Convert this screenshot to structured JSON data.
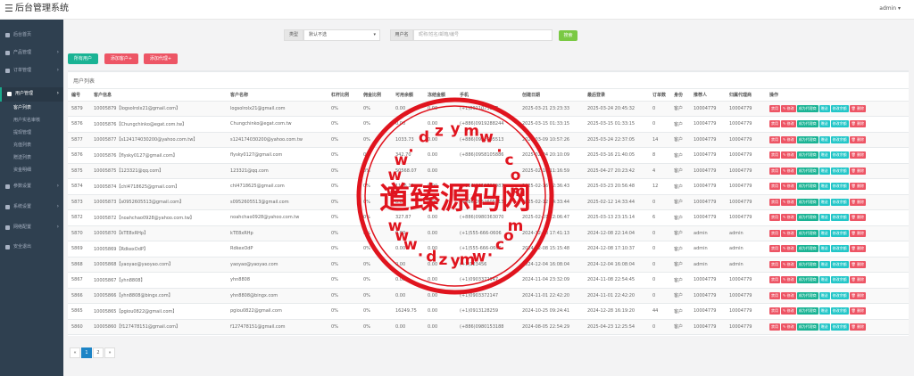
{
  "header": {
    "menu_icon": "hamburger-icon",
    "app_title": "后台管理系统",
    "user": "admin"
  },
  "sidebar": {
    "items": [
      {
        "label": "后台首页",
        "icon": "home-icon",
        "arrow": false,
        "active": false
      },
      {
        "label": "产品管理",
        "icon": "box-icon",
        "arrow": true,
        "active": false
      },
      {
        "label": "订单管理",
        "icon": "order-icon",
        "arrow": true,
        "active": false
      },
      {
        "label": "用户管理",
        "icon": "user-icon",
        "arrow": true,
        "active": true
      },
      {
        "label": "参数设置",
        "icon": "gear-icon",
        "arrow": true,
        "active": false
      },
      {
        "label": "系统设置",
        "icon": "settings-icon",
        "arrow": true,
        "active": false
      },
      {
        "label": "网络配置",
        "icon": "network-icon",
        "arrow": true,
        "active": false
      },
      {
        "label": "安全退出",
        "icon": "logout-icon",
        "arrow": false,
        "active": false
      }
    ],
    "subitems": [
      "客户列表",
      "用户实名审核",
      "提现管理",
      "充值列表",
      "赠送列表",
      "资金明细"
    ]
  },
  "filter": {
    "type_label": "类型",
    "type_value": "默认不选",
    "user_label": "用户名",
    "user_placeholder": "昵称/姓名/邮箱/编号",
    "search_button": "搜索"
  },
  "actions": {
    "all_users": "所有用户",
    "add_customer": "添加客户+",
    "add_agent": "添加代理+"
  },
  "panel_title": "用户列表",
  "table": {
    "headers": [
      "编号",
      "客户信息",
      "客户名称",
      "杠杆比例",
      "佣金比例",
      "可用余额",
      "冻结金额",
      "手机",
      "创建日期",
      "最后登录",
      "订单数",
      "身份",
      "推荐人",
      "归属代理商",
      "操作"
    ],
    "action_labels": [
      "禁用",
      "修改",
      "成为代理商",
      "赠送",
      "修改余额",
      "删除"
    ],
    "rows": [
      [
        "5879",
        "10005879【logsolrolx21@gmail.com】",
        "logsolrolx21@gmail.com",
        "0%",
        "0%",
        "0.00",
        "0.00",
        "(+1)8911073967",
        "2025-03-21 23:23:33",
        "2025-03-24 20:45:32",
        "0",
        "客户",
        "10004779",
        "10004779"
      ],
      [
        "5876",
        "10005876【Chungchinko@egat.com.tw】",
        "Chungchinko@egat.com.tw",
        "0%",
        "0%",
        "0.00",
        "0.00",
        "(+886)0919288244",
        "2025-03-15 01:33:15",
        "2025-03-15 01:33:15",
        "0",
        "客户",
        "10004779",
        "10004779"
      ],
      [
        "5877",
        "10005877【s124174030200@yahoo.com.tw】",
        "s124174030200@yahoo.com.tw",
        "0%",
        "0%",
        "1033.73",
        "0.00",
        "(+886)0952605513",
        "2025-03-09 10:57:26",
        "2025-03-24 22:37:05",
        "14",
        "客户",
        "10004779",
        "10004779"
      ],
      [
        "5876",
        "10005876【flysky0127@gmail.com】",
        "flysky0127@gmail.com",
        "0%",
        "0%",
        "342.70",
        "0.00",
        "(+886)0958105886",
        "2025-02-24 20:10:09",
        "2025-03-16 21:40:05",
        "8",
        "客户",
        "10004779",
        "10004779"
      ],
      [
        "5875",
        "10005875【123321@qq.com】",
        "123321@qq.com",
        "0%",
        "0%",
        "50568.07",
        "0.00",
        "",
        "2025-02-16 11:16:59",
        "2025-04-27 20:23:42",
        "4",
        "客户",
        "10004779",
        "10004779"
      ],
      [
        "5874",
        "10005874【chl4718625@gmail.com】",
        "chl4718625@gmail.com",
        "0%",
        "0%",
        "1176.19",
        "0.00",
        "(+886)0958723987",
        "2025-02-16 22:36:43",
        "2025-03-23 20:56:48",
        "12",
        "客户",
        "10004779",
        "10004779"
      ],
      [
        "5873",
        "10005873【s0952605513@gmail.com】",
        "s0952605513@gmail.com",
        "0%",
        "0%",
        "0.00",
        "0.00",
        "(+886)0952605513",
        "2025-02-12 14:33:44",
        "2025-02-12 14:33:44",
        "0",
        "客户",
        "10004779",
        "10004779"
      ],
      [
        "5872",
        "10005872【noahchao0928@yahoo.com.tw】",
        "noahchao0928@yahoo.com.tw",
        "0%",
        "0%",
        "327.87",
        "0.00",
        "(+886)0980363070",
        "2025-02-07 22:06:47",
        "2025-03-13 23:15:14",
        "6",
        "客户",
        "10004779",
        "10004779"
      ],
      [
        "5870",
        "10005870【kTE8xRHp】",
        "kTE8xRHp",
        "0%",
        "0%",
        "0.00",
        "0.00",
        "(+1)555-666-0606",
        "2024-12-18 17:41:13",
        "2024-12-08 22:14:04",
        "0",
        "客户",
        "admin",
        "admin"
      ],
      [
        "5869",
        "10005869【RdkexOdP】",
        "RdkexOdP",
        "0%",
        "0%",
        "0.00",
        "0.00",
        "(+1)555-666-0606",
        "2024-12-08 15:15:48",
        "2024-12-08 17:10:37",
        "0",
        "客户",
        "admin",
        "admin"
      ],
      [
        "5868",
        "10005868【yaoyao@yaoyao.com】",
        "yaoyao@yaoyao.com",
        "0%",
        "0%",
        "0.00",
        "0.00",
        "(+1)123456",
        "2024-12-04 16:08:04",
        "2024-12-04 16:08:04",
        "0",
        "客户",
        "admin",
        "admin"
      ],
      [
        "5867",
        "10005867【yhn8808】",
        "yhn8808",
        "0%",
        "0%",
        "0.00",
        "0.00",
        "(+1)0903372147",
        "2024-11-04 23:32:09",
        "2024-11-08 22:54:45",
        "0",
        "客户",
        "10004779",
        "10004779"
      ],
      [
        "5866",
        "10005866【yhn8808@bingx.com】",
        "yhn8808@bingx.com",
        "0%",
        "0%",
        "0.00",
        "0.00",
        "(+1)0903372147",
        "2024-11-01 22:42:20",
        "2024-11-01 22:42:20",
        "0",
        "客户",
        "10004779",
        "10004779"
      ],
      [
        "5865",
        "10005865【pgiou0822@gmail.com】",
        "pgiou0822@gmail.com",
        "0%",
        "0%",
        "16249.75",
        "0.00",
        "(+1)0913128259",
        "2024-10-25 09:24:41",
        "2024-12-28 16:19:20",
        "44",
        "客户",
        "10004779",
        "10004779"
      ],
      [
        "5860",
        "10005860【f127478151@gmail.com】",
        "f127478151@gmail.com",
        "0%",
        "0%",
        "0.00",
        "0.00",
        "(+886)0980153188",
        "2024-08-05 22:54:29",
        "2025-04-23 12:25:54",
        "0",
        "客户",
        "10004779",
        "10004779"
      ]
    ]
  },
  "pagination": {
    "prev": "«",
    "pages": [
      "1",
      "2"
    ],
    "next": "»",
    "current": "1"
  },
  "watermark": {
    "text": "道臻源码网",
    "letters": [
      "w",
      "w",
      "w",
      ".",
      "d",
      "z",
      "y",
      "m",
      "w",
      ".",
      "c",
      "o",
      "m"
    ],
    "color": "#e0141e"
  },
  "colors": {
    "sidebar": "#2f4050",
    "primary": "#1ab394",
    "danger": "#ed5565",
    "info": "#23c6c8",
    "success": "#7ac943",
    "page_active": "#1c84c6"
  }
}
